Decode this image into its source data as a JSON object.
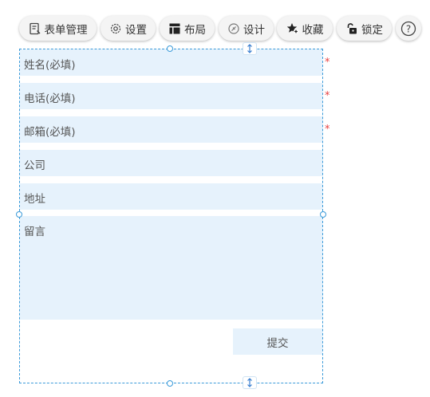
{
  "toolbar": {
    "form_manage": "表单管理",
    "settings": "设置",
    "layout": "布局",
    "design": "设计",
    "favorite": "收藏",
    "lock": "锁定",
    "help": "?"
  },
  "form": {
    "name_placeholder": "姓名(必填)",
    "phone_placeholder": "电话(必填)",
    "email_placeholder": "邮箱(必填)",
    "company_placeholder": "公司",
    "address_placeholder": "地址",
    "message_placeholder": "留言",
    "required_mark": "*",
    "submit_label": "提交"
  },
  "colors": {
    "field_bg": "#e6f2fc",
    "selection_border": "#3a9ad9",
    "required": "#e84040"
  }
}
